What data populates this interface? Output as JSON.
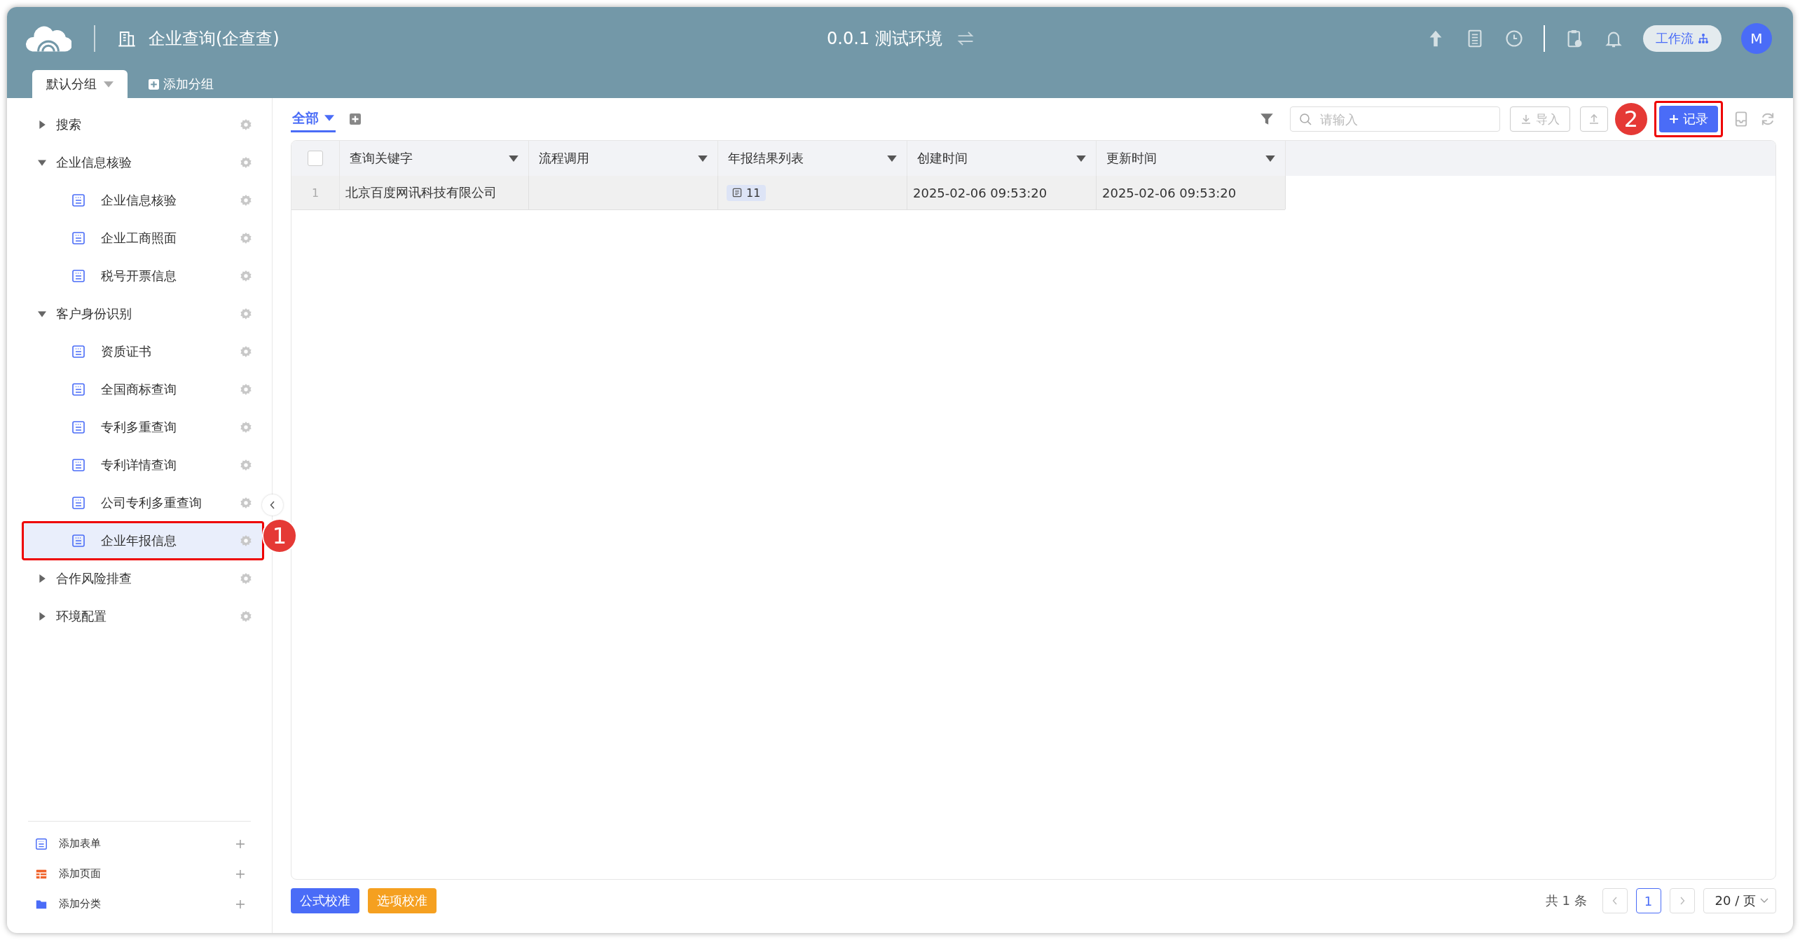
{
  "header": {
    "app_title": "企业查询(企查查)",
    "environment": "0.0.1 测试环境",
    "workflow_button": "工作流",
    "avatar": "M"
  },
  "group_tabs": [
    {
      "label": "默认分组",
      "selected": true
    }
  ],
  "add_group": "添加分组",
  "sidebar": {
    "items": [
      {
        "label": "搜索",
        "kind": "group",
        "expanded": false,
        "selected": false
      },
      {
        "label": "企业信息核验",
        "kind": "group",
        "expanded": true,
        "selected": false,
        "children": [
          {
            "label": "企业信息核验",
            "kind": "form",
            "selected": false
          },
          {
            "label": "企业工商照面",
            "kind": "form",
            "selected": false
          },
          {
            "label": "税号开票信息",
            "kind": "form",
            "selected": false
          }
        ]
      },
      {
        "label": "客户身份识别",
        "kind": "group",
        "expanded": true,
        "selected": false,
        "children": [
          {
            "label": "资质证书",
            "kind": "form",
            "selected": false
          },
          {
            "label": "全国商标查询",
            "kind": "form",
            "selected": false
          },
          {
            "label": "专利多重查询",
            "kind": "form",
            "selected": false
          },
          {
            "label": "专利详情查询",
            "kind": "form",
            "selected": false
          },
          {
            "label": "公司专利多重查询",
            "kind": "form",
            "selected": false
          },
          {
            "label": "企业年报信息",
            "kind": "form",
            "selected": true
          }
        ]
      },
      {
        "label": "合作风险排查",
        "kind": "group",
        "expanded": false,
        "selected": false
      },
      {
        "label": "环境配置",
        "kind": "group",
        "expanded": false,
        "selected": false
      }
    ],
    "footer": [
      {
        "label": "添加表单",
        "kind": "form"
      },
      {
        "label": "添加页面",
        "kind": "page"
      },
      {
        "label": "添加分类",
        "kind": "folder"
      }
    ]
  },
  "view_tabs": [
    {
      "label": "全部",
      "selected": true
    }
  ],
  "toolbar": {
    "search": {
      "placeholder": "请输入"
    },
    "import_button": "导入",
    "add_record_button": "记录"
  },
  "table": {
    "select_all_checked": false,
    "columns": [
      "查询关键字",
      "流程调用",
      "年报结果列表",
      "创建时间",
      "更新时间"
    ],
    "rows": [
      {
        "index": "1",
        "cells": [
          "北京百度网讯科技有限公司",
          "",
          "11",
          "2025-02-06 09:53:20",
          "2025-02-06 09:53:20"
        ],
        "checked": false
      }
    ]
  },
  "bottom_buttons": [
    {
      "label": "公式校准",
      "kind": "primary"
    },
    {
      "label": "选项校准",
      "kind": "warning"
    }
  ],
  "pagination": {
    "total": "共 1 条",
    "pages": [
      {
        "label": "1",
        "selected": true
      }
    ],
    "page_size": "20 / 页"
  },
  "annotations": [
    {
      "label": "1"
    },
    {
      "label": "2"
    }
  ]
}
